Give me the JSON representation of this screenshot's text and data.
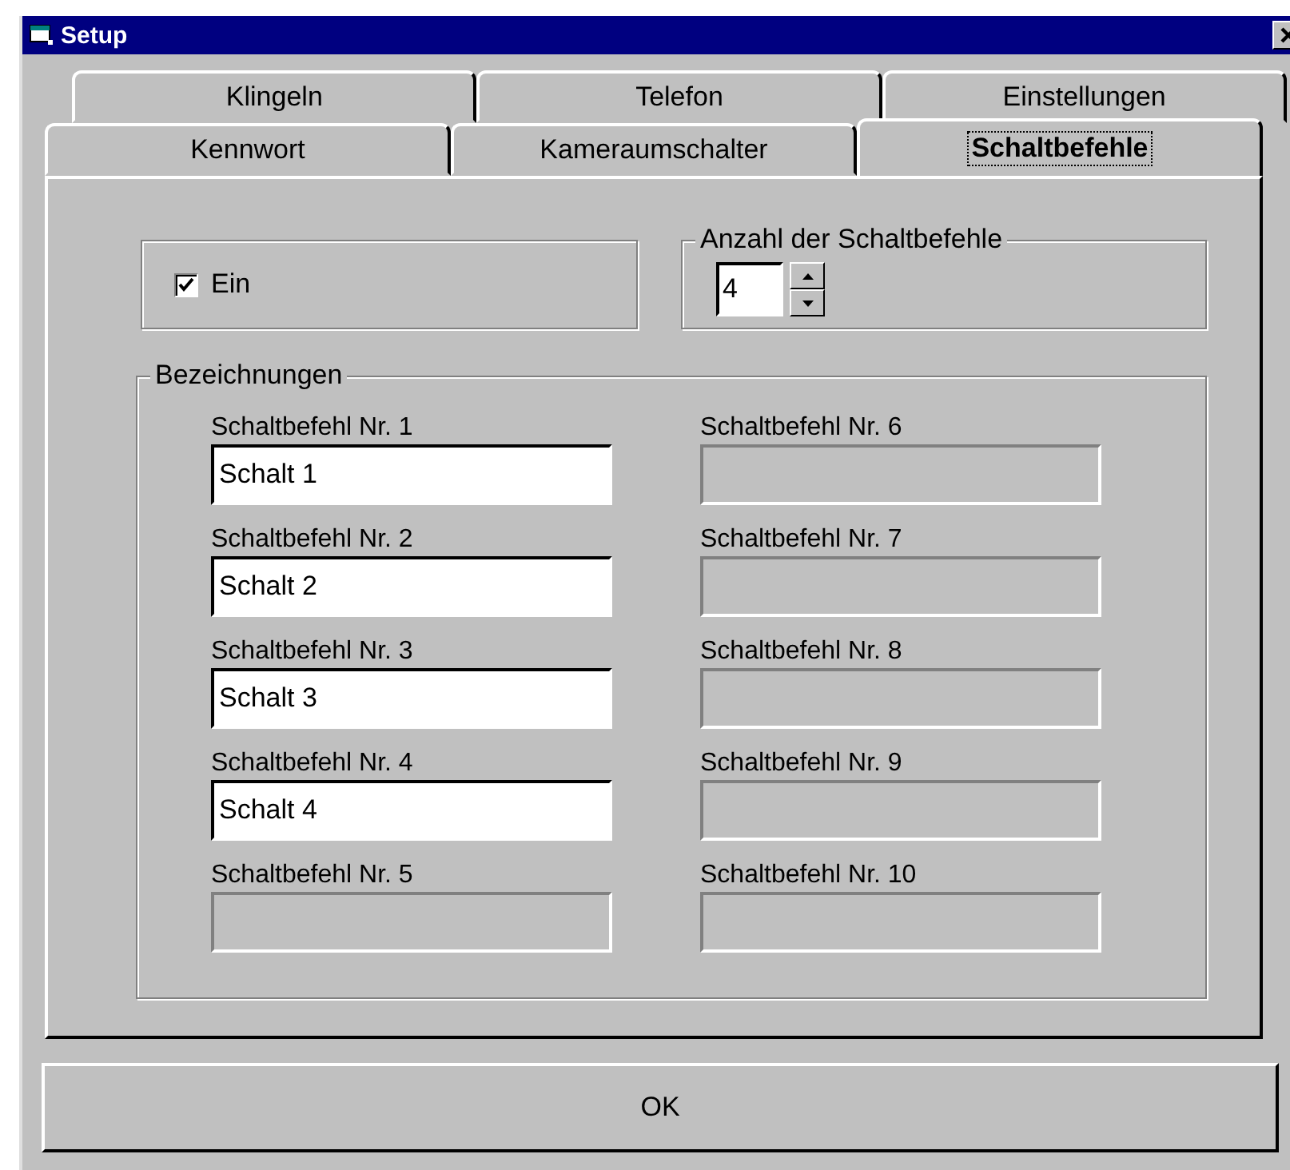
{
  "window": {
    "title": "Setup"
  },
  "tab_rows": [
    {
      "tabs": [
        {
          "label": "Klingeln",
          "selected": false
        },
        {
          "label": "Telefon",
          "selected": false
        },
        {
          "label": "Einstellungen",
          "selected": false
        }
      ]
    },
    {
      "tabs": [
        {
          "label": "Kennwort",
          "selected": false
        },
        {
          "label": "Kameraumschalter",
          "selected": false
        },
        {
          "label": "Schaltbefehle",
          "selected": true
        }
      ]
    }
  ],
  "enable": {
    "label": "Ein",
    "checked": true
  },
  "count": {
    "label": "Anzahl der Schaltbefehle",
    "value": "4"
  },
  "names": {
    "title": "Bezeichnungen",
    "fields": [
      {
        "label": "Schaltbefehl Nr. 1",
        "value": "Schalt 1",
        "disabled": false
      },
      {
        "label": "Schaltbefehl Nr. 2",
        "value": "Schalt 2",
        "disabled": false
      },
      {
        "label": "Schaltbefehl Nr. 3",
        "value": "Schalt 3",
        "disabled": false
      },
      {
        "label": "Schaltbefehl Nr. 4",
        "value": "Schalt 4",
        "disabled": false
      },
      {
        "label": "Schaltbefehl Nr. 5",
        "disabled": true
      },
      {
        "label": "Schaltbefehl Nr. 6",
        "disabled": true
      },
      {
        "label": "Schaltbefehl Nr. 7",
        "disabled": true
      },
      {
        "label": "Schaltbefehl Nr. 8",
        "disabled": true
      },
      {
        "label": "Schaltbefehl Nr. 9",
        "disabled": true
      },
      {
        "label": "Schaltbefehl Nr. 10",
        "disabled": true
      }
    ]
  },
  "ok_button": "OK"
}
